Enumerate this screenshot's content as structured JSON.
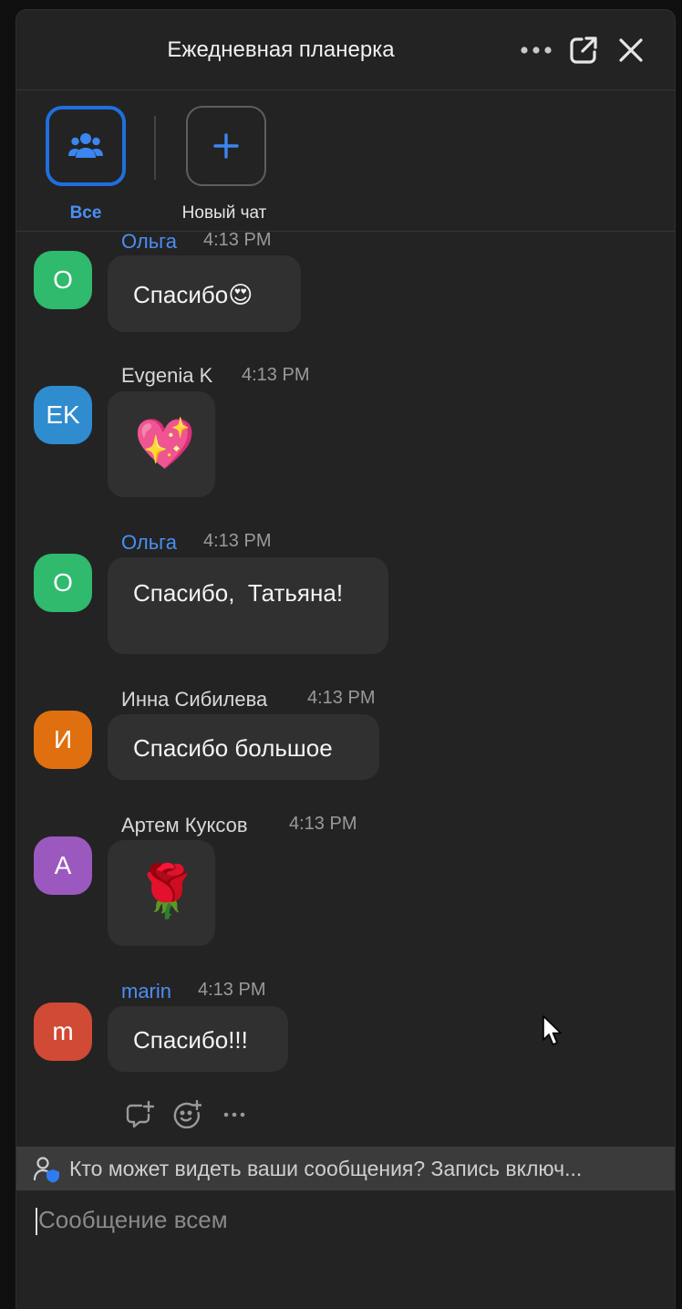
{
  "header": {
    "title": "Ежедневная планерка",
    "icons": [
      "more-icon",
      "pop-out-icon",
      "close-icon"
    ]
  },
  "tabs": [
    {
      "label": "Все",
      "icon": "people-icon",
      "selected": true
    },
    {
      "label": "Новый чат",
      "icon": "plus-icon",
      "selected": false
    }
  ],
  "messages": [
    {
      "sender": "Ольга",
      "initials": "О",
      "time": "4:13 PM",
      "text": "Спасибо😍",
      "avatar_color": "#2fba6e",
      "name_color": "#4b8ef2"
    },
    {
      "sender": "Evgenia K",
      "initials": "EK",
      "time": "4:13 PM",
      "text": "💖",
      "avatar_color": "#2f8ccf",
      "name_color": "#d8d8d8"
    },
    {
      "sender": "Ольга",
      "initials": "О",
      "time": "4:13 PM",
      "text": "Спасибо,  Татьяна!",
      "avatar_color": "#2fba6e",
      "name_color": "#4b8ef2"
    },
    {
      "sender": "Инна Сибилева",
      "initials": "И",
      "time": "4:13 PM",
      "text": "Спасибо большое",
      "avatar_color": "#e0700f",
      "name_color": "#d8d8d8"
    },
    {
      "sender": "Артем Куксов",
      "initials": "А",
      "time": "4:13 PM",
      "text": "🌹",
      "avatar_color": "#9b59c0",
      "name_color": "#d8d8d8"
    },
    {
      "sender": "marin",
      "initials": "m",
      "time": "4:13 PM",
      "text": "Спасибо!!!",
      "avatar_color": "#d04a35",
      "name_color": "#4b8ef2"
    }
  ],
  "message_actions": [
    "reply-icon",
    "add-reaction-icon",
    "more-icon"
  ],
  "notice": {
    "text": "Кто может видеть ваши сообщения? Запись включ...",
    "icon": "privacy-person-icon"
  },
  "compose": {
    "placeholder": "Сообщение всем"
  },
  "colors": {
    "accent": "#1f6fde",
    "panel": "#232323",
    "bubble": "#303030"
  }
}
